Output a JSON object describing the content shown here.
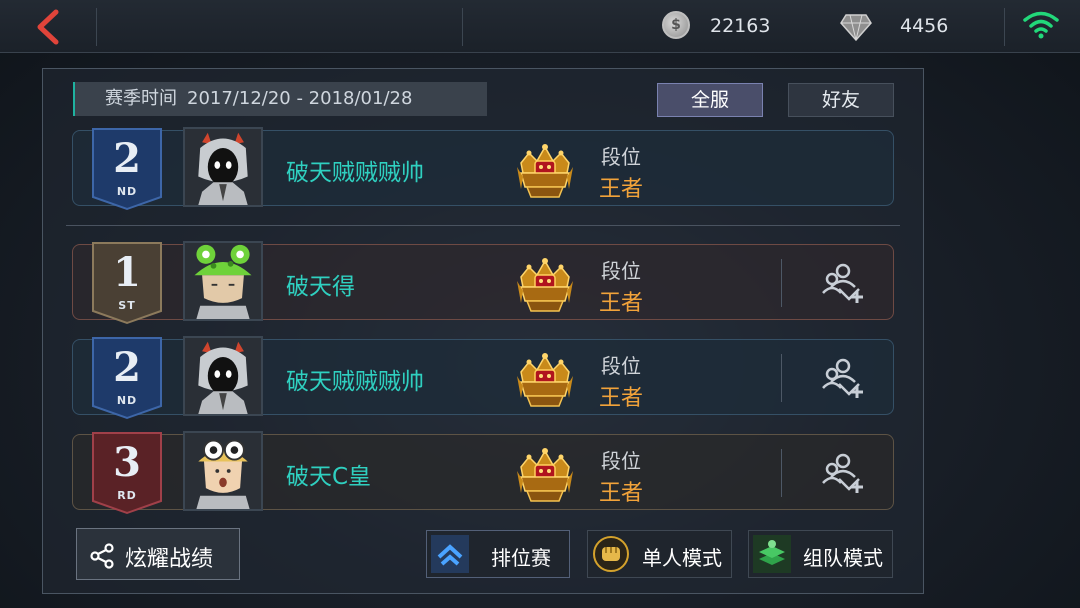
{
  "topbar": {
    "coins": "22163",
    "gems": "4456",
    "coin_icon": "coin-icon",
    "gem_icon": "gem-icon",
    "wifi_icon": "wifi-icon"
  },
  "season": {
    "label": "赛季时间",
    "range": "2017/12/20 - 2018/01/28"
  },
  "tabs": [
    {
      "label": "全服",
      "active": true
    },
    {
      "label": "好友",
      "active": false
    }
  ],
  "my_rank": {
    "rank": "2",
    "suffix": "ND",
    "name": "破天贼贼贼帅",
    "tier_label": "段位",
    "tier": "王者"
  },
  "rows": [
    {
      "rank": "1",
      "suffix": "ST",
      "name": "破天得",
      "tier_label": "段位",
      "tier": "王者"
    },
    {
      "rank": "2",
      "suffix": "ND",
      "name": "破天贼贼贼帅",
      "tier_label": "段位",
      "tier": "王者"
    },
    {
      "rank": "3",
      "suffix": "RD",
      "name": "破天C皇",
      "tier_label": "段位",
      "tier": "王者"
    }
  ],
  "bottom": {
    "share": "炫耀战绩",
    "ranked": "排位赛",
    "solo": "单人模式",
    "team": "组队模式"
  },
  "colors": {
    "name": "#2fd0c0",
    "tier": "#f2a33a",
    "accent_teal": "#1fb2a0"
  }
}
